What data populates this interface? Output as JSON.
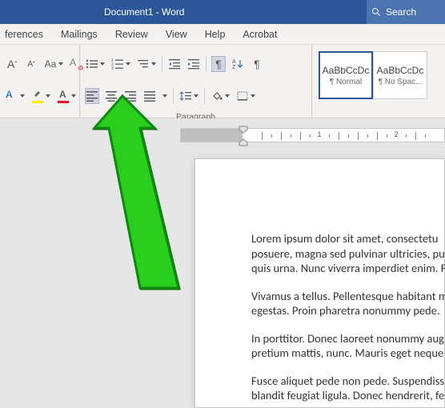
{
  "title": "Document1 - Word",
  "search": {
    "placeholder": "Search"
  },
  "tabs": [
    "ferences",
    "Mailings",
    "Review",
    "View",
    "Help",
    "Acrobat"
  ],
  "font": {
    "grow": "A",
    "shrink": "A",
    "case": "Aa",
    "clear": "A"
  },
  "groups": {
    "font": "",
    "para": "Paragraph",
    "styles": ""
  },
  "styles": [
    {
      "preview": "AaBbCcDc",
      "name": "¶ Normal"
    },
    {
      "preview": "AaBbCcDc",
      "name": "¶ No Spac..."
    }
  ],
  "ruler": {
    "labels": [
      "1",
      "2"
    ]
  },
  "doc": {
    "p1a": "Lorem ipsum dolor sit amet, consectetu",
    "p1b": "posuere, magna sed pulvinar ultricies, pu",
    "p1c": "quis urna. Nunc viverra imperdiet enim. F",
    "p2a": "Vivamus a tellus. Pellentesque habitant m",
    "p2b": "egestas. Proin pharetra nonummy pede.",
    "p3a": "In porttitor. Donec laoreet nonummy aug",
    "p3b": "pretium mattis, nunc. Mauris eget neque",
    "p4a": "Fusce aliquet pede non pede. Suspendiss",
    "p4b": "blandit feugiat ligula. Donec hendrerit, fe"
  }
}
